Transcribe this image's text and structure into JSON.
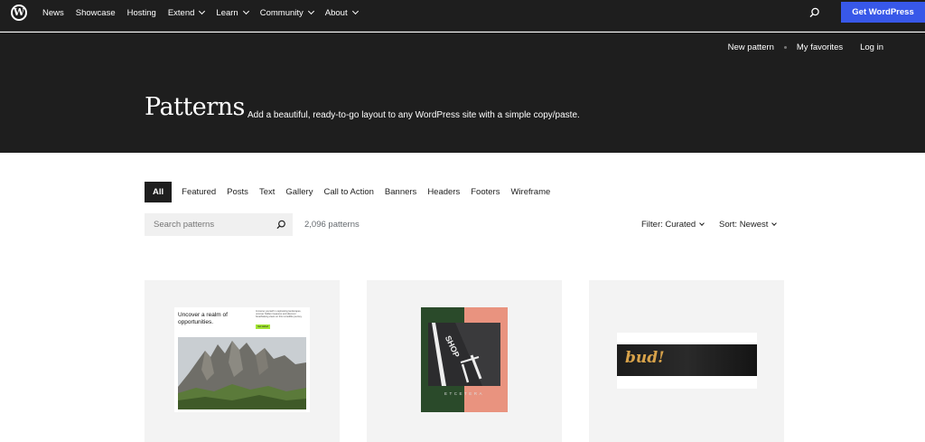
{
  "nav": {
    "logo_letter": "W",
    "items": [
      {
        "label": "News",
        "dropdown": false
      },
      {
        "label": "Showcase",
        "dropdown": false
      },
      {
        "label": "Hosting",
        "dropdown": false
      },
      {
        "label": "Extend",
        "dropdown": true
      },
      {
        "label": "Learn",
        "dropdown": true
      },
      {
        "label": "Community",
        "dropdown": true
      },
      {
        "label": "About",
        "dropdown": true
      }
    ],
    "cta_label": "Get WordPress",
    "cta_color": "#3858e9"
  },
  "subnav": {
    "new_pattern": "New pattern",
    "favorites": "My favorites",
    "login": "Log in"
  },
  "hero": {
    "title": "Patterns",
    "subtitle": "Add a beautiful, ready-to-go layout to any WordPress site with a simple copy/paste."
  },
  "tabs": [
    {
      "label": "All",
      "active": true
    },
    {
      "label": "Featured",
      "active": false
    },
    {
      "label": "Posts",
      "active": false
    },
    {
      "label": "Text",
      "active": false
    },
    {
      "label": "Gallery",
      "active": false
    },
    {
      "label": "Call to Action",
      "active": false
    },
    {
      "label": "Banners",
      "active": false
    },
    {
      "label": "Headers",
      "active": false
    },
    {
      "label": "Footers",
      "active": false
    },
    {
      "label": "Wireframe",
      "active": false
    }
  ],
  "search": {
    "placeholder": "Search patterns",
    "value": ""
  },
  "results": {
    "count": "2,096 patterns"
  },
  "filter": {
    "label": "Filter: Curated"
  },
  "sort": {
    "label": "Sort: Newest"
  },
  "cards": {
    "c1": {
      "title": "Uncover a realm of opportunities.",
      "body": "Immerse yourself in captivating landscapes, uncover hidden treasures and discover breathtaking views on this incredible journey.",
      "button": "Get started"
    },
    "c2": {
      "road_text": "SHOP",
      "caption": "ETCETERA"
    },
    "c3": {
      "banner_text": "bud!"
    }
  }
}
